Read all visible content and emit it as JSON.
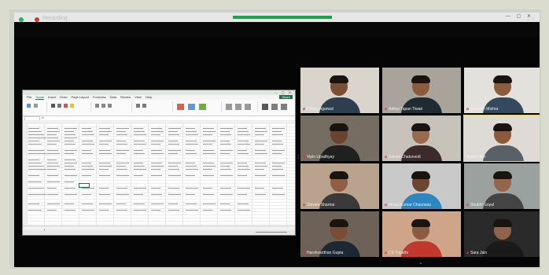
{
  "window": {
    "title": "",
    "system_icons": "— ▢ ✕"
  },
  "meeting": {
    "recording_label": "Recording",
    "view_label": "▯ V"
  },
  "excel": {
    "file_name": "",
    "menu": [
      "File",
      "Home",
      "Insert",
      "Draw",
      "Page Layout",
      "Formulas",
      "Data",
      "Review",
      "View",
      "Help"
    ],
    "active_menu": "Home",
    "share_label": "Share",
    "sheets": [
      "",
      "",
      "",
      ""
    ],
    "active_sheet_index": 3
  },
  "participants": [
    {
      "name": "Chirag Agarwal",
      "muted": true,
      "bg": "#d9d5cc",
      "skin": "#7a4e35",
      "shirt": "#2c3e50"
    },
    {
      "name": "Aditya Tapan Tiwari",
      "muted": true,
      "bg": "#a9a49b",
      "skin": "#8a5a3c",
      "shirt": "#1f2a33"
    },
    {
      "name": "Saurabh Mishra",
      "muted": true,
      "bg": "#e3e1dc",
      "skin": "#8d5b3d",
      "shirt": "#34495e"
    },
    {
      "name": "Vipin Upadhyay",
      "muted": true,
      "bg": "#756c62",
      "skin": "#6b4430",
      "shirt": "#202020"
    },
    {
      "name": "Sakshi Chaturvedi",
      "muted": true,
      "bg": "#c7c2ba",
      "skin": "#9a6a4c",
      "shirt": "#3b2b2b"
    },
    {
      "name": "Ayush Jain",
      "muted": false,
      "bg": "#dedbd6",
      "skin": "#8b5a3b",
      "shirt": "#596066"
    },
    {
      "name": "Shivani Sharma",
      "muted": true,
      "bg": "#b9a38f",
      "skin": "#8e5f43",
      "shirt": "#3a3a3a"
    },
    {
      "name": "Mridul Kumar Chaurasia",
      "muted": true,
      "bg": "#c9c9c9",
      "skin": "#6d4632",
      "shirt": "#2e86c1"
    },
    {
      "name": "Shubhi Goyal",
      "muted": true,
      "bg": "#9aa19f",
      "skin": "#93654a",
      "shirt": "#444444"
    },
    {
      "name": "Harshvardhan Gupta",
      "muted": true,
      "bg": "#6e6258",
      "skin": "#7b4c34",
      "shirt": "#1c2833"
    },
    {
      "name": "CS Tripathi",
      "muted": true,
      "bg": "#cfa58a",
      "skin": "#8c5a3e",
      "shirt": "#c0392b"
    },
    {
      "name": "Sara Jain",
      "muted": true,
      "bg": "#2a2a2a",
      "skin": "#90634a",
      "shirt": "#1a1a1a"
    }
  ],
  "colors": {
    "share_strip": "#1aa34a",
    "recording_dot": "#d23b2f",
    "excel_green": "#1d6f42",
    "active_speaker": "#e8d75c"
  }
}
